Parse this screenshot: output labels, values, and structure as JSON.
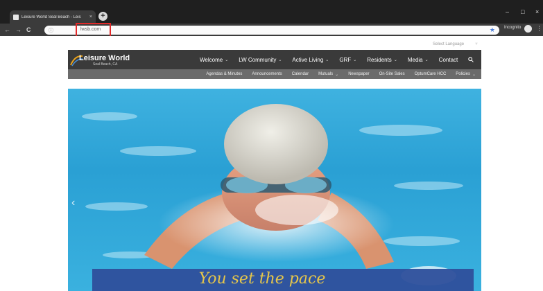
{
  "browser": {
    "tab_title": "Leisure World Seal Beach - Leis",
    "tab_close": "×",
    "new_tab": "+",
    "window_controls": {
      "minimize": "–",
      "maximize": "□",
      "close": "×"
    },
    "nav": {
      "back": "←",
      "forward": "→",
      "reload": "C"
    },
    "url": "lwsb.com",
    "incognito_label": "Incognito",
    "menu_glyph": "⋮",
    "star_glyph": "★"
  },
  "site": {
    "language_select": "Select Language",
    "logo": {
      "name": "Leisure World",
      "subtitle": "Seal Beach, CA"
    },
    "main_menu": [
      {
        "label": "Welcome",
        "has_dropdown": true
      },
      {
        "label": "LW Community",
        "has_dropdown": true
      },
      {
        "label": "Active Living",
        "has_dropdown": true
      },
      {
        "label": "GRF",
        "has_dropdown": true
      },
      {
        "label": "Residents",
        "has_dropdown": true
      },
      {
        "label": "Media",
        "has_dropdown": true
      },
      {
        "label": "Contact",
        "has_dropdown": false
      }
    ],
    "sub_menu": [
      {
        "label": "Agendas & Minutes",
        "has_dropdown": false
      },
      {
        "label": "Announcements",
        "has_dropdown": false
      },
      {
        "label": "Calendar",
        "has_dropdown": false
      },
      {
        "label": "Mutuals",
        "has_dropdown": true
      },
      {
        "label": "Newspaper",
        "has_dropdown": false
      },
      {
        "label": "On-Site Sales",
        "has_dropdown": false
      },
      {
        "label": "OptumCare HCC",
        "has_dropdown": false
      },
      {
        "label": "Policies",
        "has_dropdown": true
      }
    ],
    "hero": {
      "tagline": "You set the pace",
      "prev_glyph": "‹"
    }
  },
  "colors": {
    "chrome_dark": "#1f1f1f",
    "chrome_toolbar": "#3b3b3b",
    "nav_bar": "#3a3a3a",
    "sub_nav": "#6b6b6b",
    "highlight": "#e12a2a",
    "pool_blue": "#2aa0d4",
    "tagline_band": "#2e4f9b",
    "tagline_text": "#e6c64a"
  }
}
